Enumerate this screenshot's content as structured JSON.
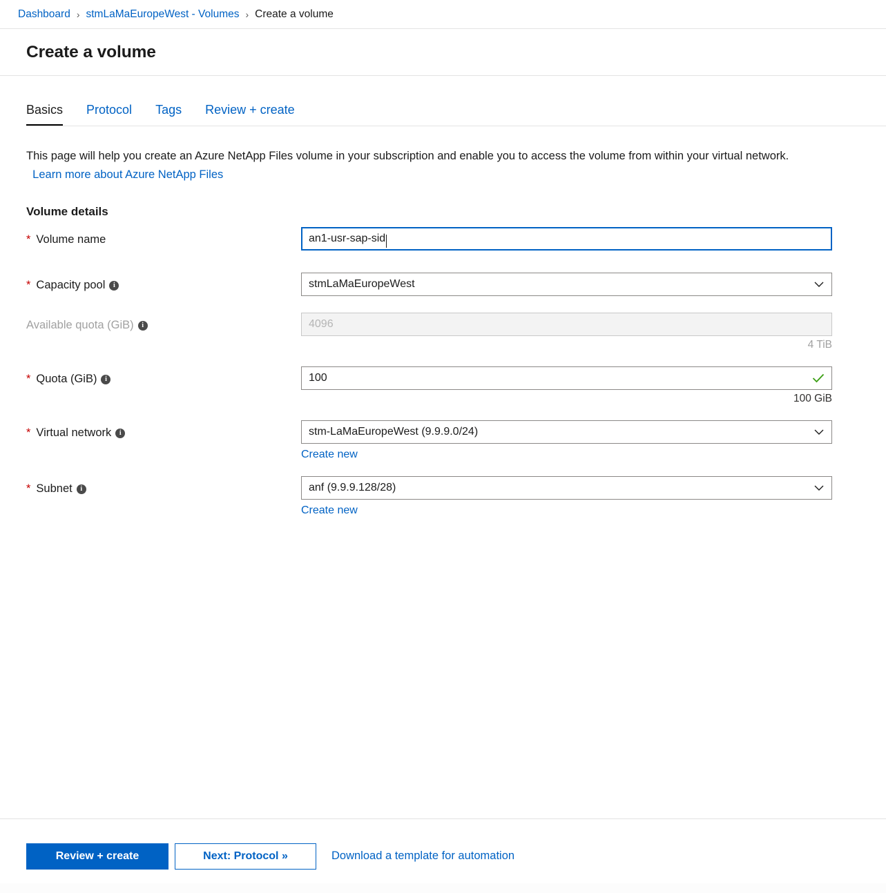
{
  "breadcrumb": {
    "items": [
      {
        "label": "Dashboard",
        "current": false
      },
      {
        "label": "stmLaMaEuropeWest - Volumes",
        "current": false
      },
      {
        "label": "Create a volume",
        "current": true
      }
    ],
    "separator": "›"
  },
  "header": {
    "title": "Create a volume"
  },
  "tabs": [
    {
      "label": "Basics",
      "active": true
    },
    {
      "label": "Protocol",
      "active": false
    },
    {
      "label": "Tags",
      "active": false
    },
    {
      "label": "Review + create",
      "active": false
    }
  ],
  "intro": {
    "text": "This page will help you create an Azure NetApp Files volume in your subscription and enable you to access the volume from within your virtual network.",
    "link": "Learn more about Azure NetApp Files"
  },
  "section": {
    "heading": "Volume details"
  },
  "fields": {
    "volume_name": {
      "label": "Volume name",
      "required_marker": "*",
      "value": "an1-usr-sap-sid"
    },
    "capacity_pool": {
      "label": "Capacity pool",
      "required_marker": "*",
      "info": "i",
      "value": "stmLaMaEuropeWest"
    },
    "available_quota": {
      "label": "Available quota (GiB)",
      "info": "i",
      "value": "4096",
      "hint": "4 TiB"
    },
    "quota": {
      "label": "Quota (GiB)",
      "required_marker": "*",
      "info": "i",
      "value": "100",
      "hint": "100 GiB",
      "valid": true
    },
    "virtual_network": {
      "label": "Virtual network",
      "required_marker": "*",
      "info": "i",
      "value": "stm-LaMaEuropeWest (9.9.9.0/24)",
      "create_new": "Create new"
    },
    "subnet": {
      "label": "Subnet",
      "required_marker": "*",
      "info": "i",
      "value": "anf (9.9.9.128/28)",
      "create_new": "Create new"
    }
  },
  "footer": {
    "review_create": "Review + create",
    "next": "Next: Protocol »",
    "download_template": "Download a template for automation"
  },
  "colors": {
    "accent": "#0062c4",
    "required": "#c60000",
    "success": "#3ea017",
    "border": "#8a8886",
    "disabled_bg": "#f3f3f3"
  }
}
